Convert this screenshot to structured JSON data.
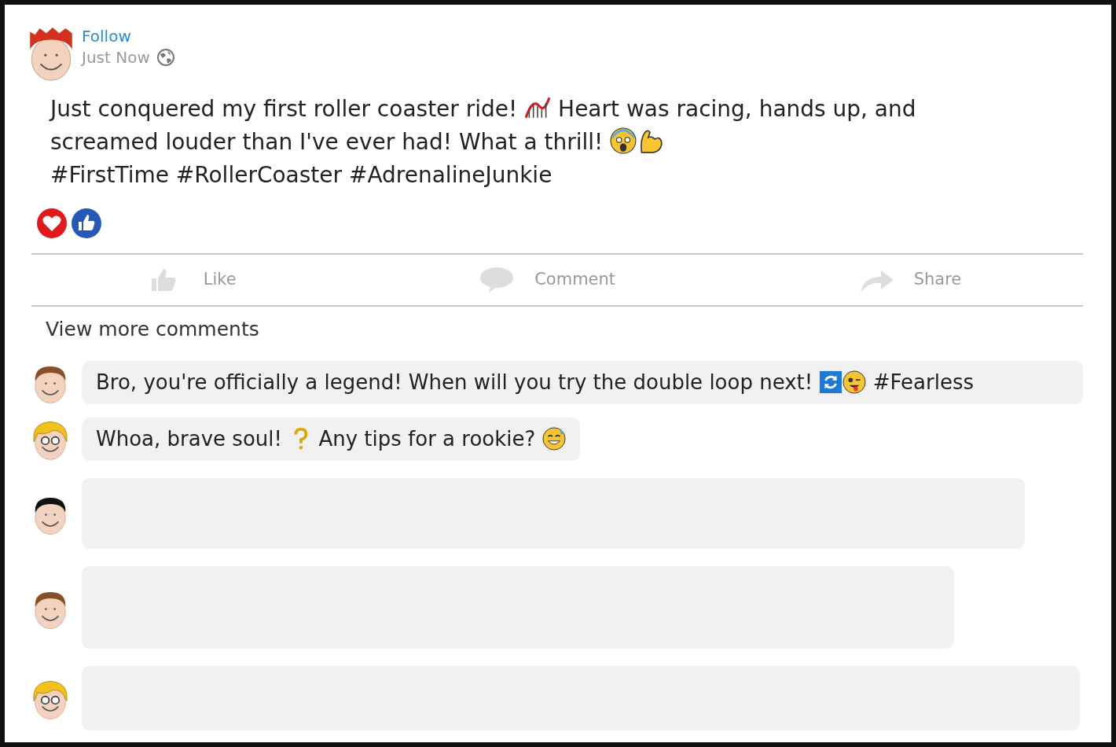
{
  "post": {
    "follow": "Follow",
    "time": "Just Now",
    "body": [
      [
        {
          "kind": "text",
          "text": "Just conquered my first roller coaster ride! "
        },
        {
          "kind": "coaster"
        },
        {
          "kind": "text",
          "text": " Heart was racing, hands up, and"
        }
      ],
      [
        {
          "kind": "text",
          "text": "screamed louder than I've ever had! What a thrill! "
        },
        {
          "kind": "scream"
        },
        {
          "kind": "muscle"
        }
      ],
      [
        {
          "kind": "text",
          "text": "#FirstTime #RollerCoaster #AdrenalineJunkie"
        }
      ]
    ]
  },
  "actions": [
    {
      "kind": "like",
      "label": "Like"
    },
    {
      "kind": "comment",
      "label": "Comment"
    },
    {
      "kind": "share",
      "label": "Share"
    }
  ],
  "view_more": "View more comments",
  "comments": [
    {
      "kind": "text",
      "parts": [
        {
          "kind": "text",
          "text": "Bro, you're officially a legend! When will you try the double loop next! "
        },
        {
          "kind": "repeat"
        },
        {
          "kind": "wink"
        },
        {
          "kind": "text",
          "text": " #Fearless"
        }
      ]
    },
    {
      "kind": "text",
      "parts": [
        {
          "kind": "text",
          "text": "Whoa, brave soul! "
        },
        {
          "kind": "thinking"
        },
        {
          "kind": "text",
          "text": " Any tips for a rookie? "
        },
        {
          "kind": "sweat"
        }
      ]
    },
    {
      "kind": "skeleton"
    },
    {
      "kind": "skeleton"
    },
    {
      "kind": "skeleton"
    }
  ]
}
